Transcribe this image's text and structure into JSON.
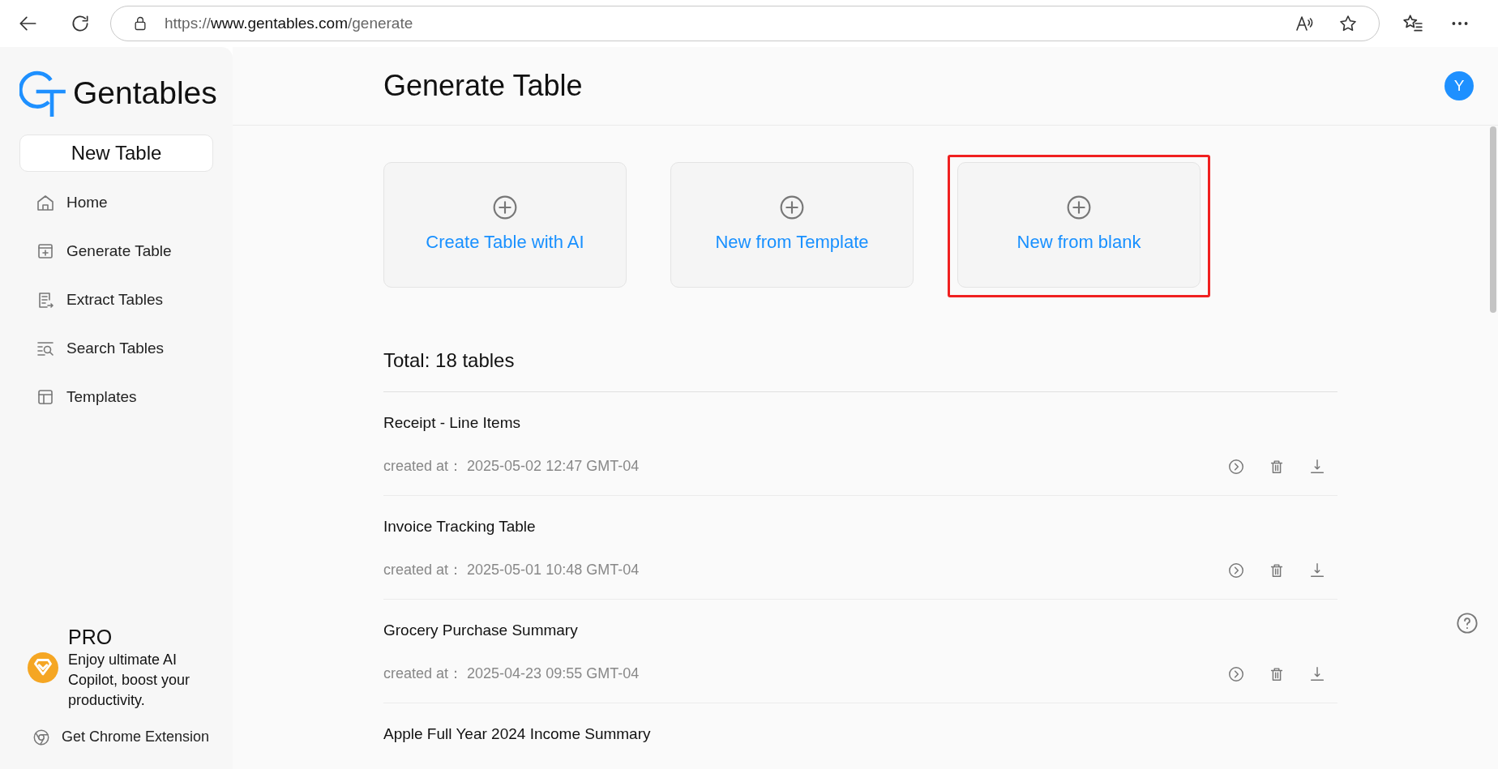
{
  "browser": {
    "url_scheme": "https://",
    "url_host": "www.gentables.com",
    "url_path": "/generate"
  },
  "sidebar": {
    "logo_text": "Gentables",
    "new_table_button": "New Table",
    "nav": [
      {
        "label": "Home",
        "kind": "home",
        "selected": false
      },
      {
        "label": "Generate Table",
        "kind": "generate",
        "selected": false
      },
      {
        "label": "Extract Tables",
        "kind": "extract",
        "selected": false
      },
      {
        "label": "Search Tables",
        "kind": "search",
        "selected": false
      },
      {
        "label": "Templates",
        "kind": "templates",
        "selected": false
      }
    ],
    "pro": {
      "title": "PRO",
      "text": "Enjoy ultimate AI Copilot, boost your productivity."
    },
    "extension_link": "Get Chrome Extension"
  },
  "header": {
    "title": "Generate Table",
    "avatar": "Y"
  },
  "cards": [
    {
      "label": "Create Table with AI",
      "highlighted": false
    },
    {
      "label": "New from Template",
      "highlighted": false
    },
    {
      "label": "New from blank",
      "highlighted": true
    }
  ],
  "total": "Total: 18 tables",
  "tables": [
    {
      "name": "Receipt - Line Items",
      "created_label": "created at：",
      "created": "2025-05-02 12:47 GMT-04"
    },
    {
      "name": "Invoice Tracking Table",
      "created_label": "created at：",
      "created": "2025-05-01 10:48 GMT-04"
    },
    {
      "name": "Grocery Purchase Summary",
      "created_label": "created at：",
      "created": "2025-04-23 09:55 GMT-04"
    },
    {
      "name": "Apple Full Year 2024 Income Summary"
    }
  ]
}
